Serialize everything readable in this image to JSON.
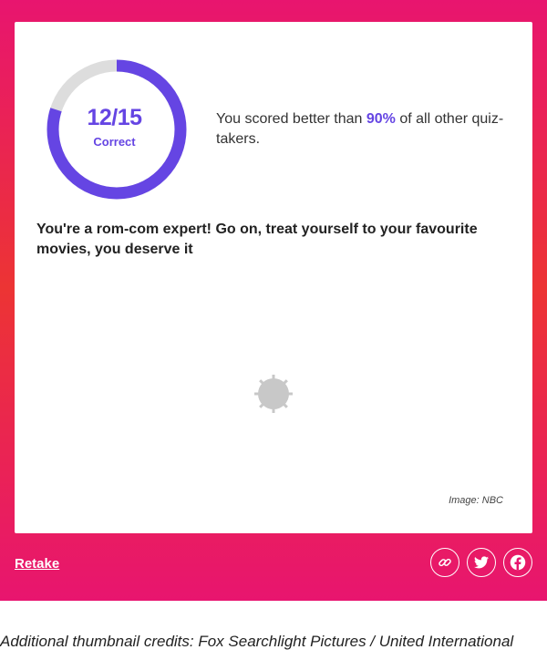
{
  "result": {
    "score": "12/15",
    "score_label": "Correct",
    "score_fraction": 0.8,
    "percentile_prefix": "You scored better than ",
    "percentile": "90%",
    "percentile_suffix": " of all other quiz-takers.",
    "message": "You're a rom-com expert! Go on, treat yourself to your favourite movies, you deserve it",
    "image_credit": "Image: NBC"
  },
  "actions": {
    "retake_label": "Retake",
    "share_icons": [
      "link-icon",
      "twitter-icon",
      "facebook-icon"
    ]
  },
  "footer": {
    "credits": "Additional thumbnail credits: Fox Searchlight Pictures / United International"
  },
  "colors": {
    "accent": "#6545e3",
    "ring_track": "#dddddd",
    "panel_pink": "#e8156f",
    "panel_red": "#ec3434"
  }
}
